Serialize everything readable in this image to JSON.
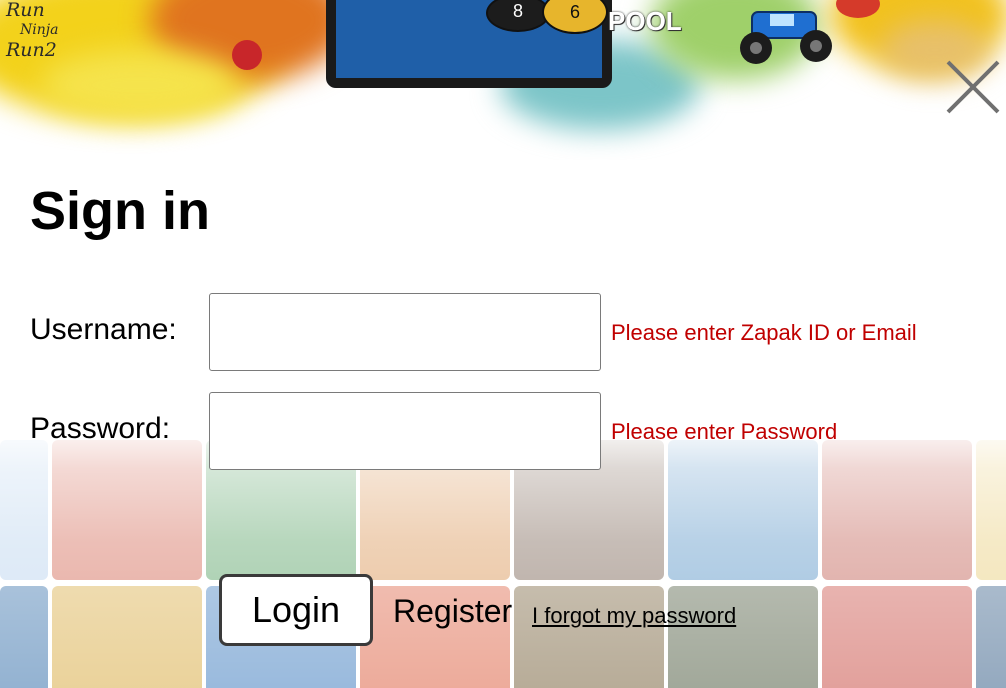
{
  "banner": {
    "game_logo_lines": [
      "Run",
      "Ninja",
      "Run2"
    ],
    "pool_word": "POOL",
    "ball_numbers": [
      "8",
      "6"
    ]
  },
  "form": {
    "title": "Sign in",
    "username": {
      "label": "Username:",
      "value": "",
      "error": "Please enter Zapak ID or Email"
    },
    "password": {
      "label": "Password:",
      "value": "",
      "error": "Please enter Password"
    },
    "login_label": "Login",
    "register_label": "Register",
    "forgot_label": "I forgot my password"
  },
  "icons": {
    "close": "close-icon"
  },
  "colors": {
    "error": "#c00000",
    "text": "#000000",
    "field_border": "#7a7a7a",
    "button_border": "#3a3a3a"
  }
}
